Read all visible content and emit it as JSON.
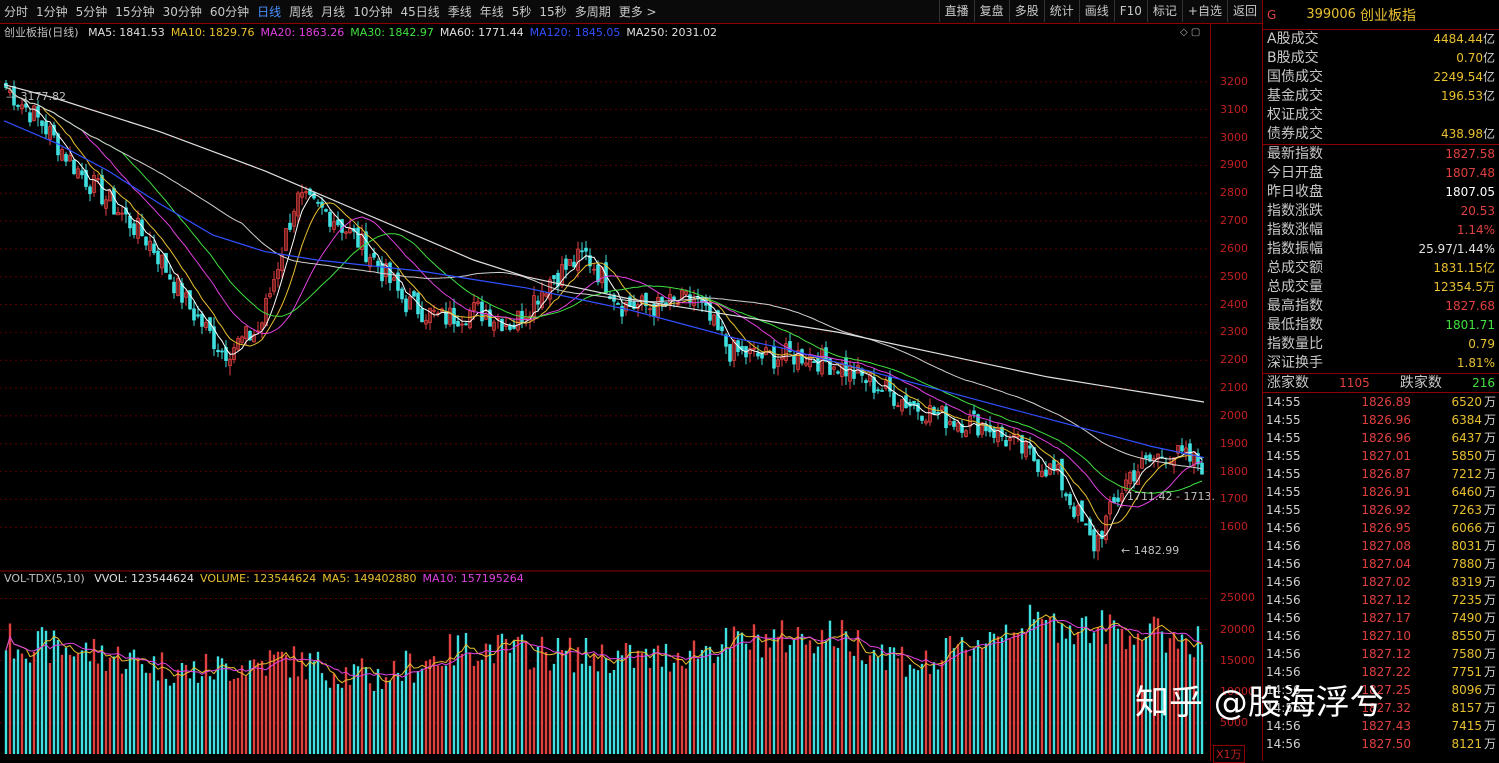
{
  "toolbar": {
    "periods": [
      "分时",
      "1分钟",
      "5分钟",
      "15分钟",
      "30分钟",
      "60分钟",
      "日线",
      "周线",
      "月线",
      "10分钟",
      "45日线",
      "季线",
      "年线",
      "5秒",
      "15秒",
      "多周期",
      "更多 >"
    ],
    "active_period": "日线",
    "right_buttons": [
      "直播",
      "复盘",
      "多股",
      "统计",
      "画线",
      "F10",
      "标记",
      "+自选",
      "返回"
    ]
  },
  "main_legend": {
    "title": "创业板指(日线)",
    "items": [
      {
        "label": "MA5: 1841.53",
        "color": "#e0e0e0"
      },
      {
        "label": "MA10: 1829.76",
        "color": "#e8c030"
      },
      {
        "label": "MA20: 1863.26",
        "color": "#e040e0"
      },
      {
        "label": "MA30: 1842.97",
        "color": "#40e040"
      },
      {
        "label": "MA60: 1771.44",
        "color": "#e0e0e0"
      },
      {
        "label": "MA120: 1845.05",
        "color": "#3050ff"
      },
      {
        "label": "MA250: 2031.02",
        "color": "#e0e0e0"
      }
    ]
  },
  "vol_legend": {
    "title": "VOL-TDX(5,10)",
    "items": [
      {
        "label": "VVOL: 123544624",
        "color": "#e0e0e0"
      },
      {
        "label": "VOLUME: 123544624",
        "color": "#e8c030"
      },
      {
        "label": "MA5: 149402880",
        "color": "#e8c030"
      },
      {
        "label": "MA10: 157195264",
        "color": "#e040e0"
      }
    ]
  },
  "annotations": {
    "high": "3177.82",
    "low": "1482.99",
    "range": "1711.42 - 1713."
  },
  "y_axis": {
    "price_ticks": [
      "3200",
      "3100",
      "3000",
      "2900",
      "2800",
      "2700",
      "2600",
      "2500",
      "2400",
      "2300",
      "2200",
      "2100",
      "2000",
      "1900",
      "1800",
      "1700",
      "1600"
    ],
    "vol_ticks": [
      "25000",
      "20000",
      "15000",
      "10000",
      "5000"
    ],
    "unit": "X1万"
  },
  "colors": {
    "up": "#e04040",
    "down": "#40e0e0",
    "ma250": "#e0e0e0",
    "ma120": "#3050ff",
    "ma60": "#d0d0d0",
    "ma30": "#40e040",
    "ma20": "#e040e0",
    "ma10": "#e8c030",
    "ma5": "#ffffff"
  },
  "panel": {
    "marker": "G",
    "code": "399006",
    "name": "创业板指",
    "turnover": [
      {
        "k": "A股成交",
        "v": "4484.44",
        "u": "亿",
        "c": "#e8c030"
      },
      {
        "k": "B股成交",
        "v": "0.70",
        "u": "亿",
        "c": "#e8c030"
      },
      {
        "k": "国债成交",
        "v": "2249.54",
        "u": "亿",
        "c": "#e8c030"
      },
      {
        "k": "基金成交",
        "v": "196.53",
        "u": "亿",
        "c": "#e8c030"
      },
      {
        "k": "权证成交",
        "v": "",
        "u": "",
        "c": "#e8c030"
      },
      {
        "k": "债券成交",
        "v": "438.98",
        "u": "亿",
        "c": "#e8c030"
      }
    ],
    "stats": [
      {
        "k": "最新指数",
        "v": "1827.58",
        "c": "#e04040"
      },
      {
        "k": "今日开盘",
        "v": "1807.48",
        "c": "#e04040"
      },
      {
        "k": "昨日收盘",
        "v": "1807.05",
        "c": "#ffffff"
      },
      {
        "k": "指数涨跌",
        "v": "20.53",
        "c": "#e04040"
      },
      {
        "k": "指数涨幅",
        "v": "1.14%",
        "c": "#e04040"
      },
      {
        "k": "指数振幅",
        "v": "25.97/1.44%",
        "c": "#e0e0e0"
      },
      {
        "k": "总成交额",
        "v": "1831.15亿",
        "c": "#e8c030"
      },
      {
        "k": "总成交量",
        "v": "12354.5万",
        "c": "#e8c030"
      },
      {
        "k": "最高指数",
        "v": "1827.68",
        "c": "#e04040"
      },
      {
        "k": "最低指数",
        "v": "1801.71",
        "c": "#40e040"
      },
      {
        "k": "指数量比",
        "v": "0.79",
        "c": "#e8c030"
      },
      {
        "k": "深证换手",
        "v": "1.81%",
        "c": "#e8c030"
      }
    ],
    "breadth": {
      "up_label": "涨家数",
      "up": "1105",
      "down_label": "跌家数",
      "down": "216"
    },
    "ticks": [
      {
        "t": "14:55",
        "p": "1826.89",
        "q": "6520",
        "u": "万"
      },
      {
        "t": "14:55",
        "p": "1826.96",
        "q": "6384",
        "u": "万"
      },
      {
        "t": "14:55",
        "p": "1826.96",
        "q": "6437",
        "u": "万"
      },
      {
        "t": "14:55",
        "p": "1827.01",
        "q": "5850",
        "u": "万"
      },
      {
        "t": "14:55",
        "p": "1826.87",
        "q": "7212",
        "u": "万"
      },
      {
        "t": "14:55",
        "p": "1826.91",
        "q": "6460",
        "u": "万"
      },
      {
        "t": "14:55",
        "p": "1826.92",
        "q": "7263",
        "u": "万"
      },
      {
        "t": "14:56",
        "p": "1826.95",
        "q": "6066",
        "u": "万"
      },
      {
        "t": "14:56",
        "p": "1827.08",
        "q": "8031",
        "u": "万"
      },
      {
        "t": "14:56",
        "p": "1827.04",
        "q": "7880",
        "u": "万"
      },
      {
        "t": "14:56",
        "p": "1827.02",
        "q": "8319",
        "u": "万"
      },
      {
        "t": "14:56",
        "p": "1827.12",
        "q": "7235",
        "u": "万"
      },
      {
        "t": "14:56",
        "p": "1827.17",
        "q": "7490",
        "u": "万"
      },
      {
        "t": "14:56",
        "p": "1827.10",
        "q": "8550",
        "u": "万"
      },
      {
        "t": "14:56",
        "p": "1827.12",
        "q": "7580",
        "u": "万"
      },
      {
        "t": "14:56",
        "p": "1827.22",
        "q": "7751",
        "u": "万"
      },
      {
        "t": "14:56",
        "p": "1827.25",
        "q": "8096",
        "u": "万"
      },
      {
        "t": "14:56",
        "p": "1827.32",
        "q": "8157",
        "u": "万"
      },
      {
        "t": "14:56",
        "p": "1827.43",
        "q": "7415",
        "u": "万"
      },
      {
        "t": "14:56",
        "p": "1827.50",
        "q": "8121",
        "u": "万"
      }
    ]
  },
  "watermark": "知乎 @股海浮兮",
  "chart_data": {
    "type": "line",
    "price_range": [
      1450,
      3300
    ],
    "series": [
      {
        "name": "MA250",
        "values": [
          3190,
          3140,
          3080,
          3020,
          2950,
          2880,
          2800,
          2720,
          2640,
          2560,
          2500,
          2460,
          2420,
          2390,
          2360,
          2330,
          2300,
          2260,
          2220,
          2180,
          2140,
          2110,
          2080,
          2050
        ]
      },
      {
        "name": "MA120",
        "values": [
          3060,
          2980,
          2880,
          2760,
          2650,
          2590,
          2560,
          2540,
          2520,
          2490,
          2460,
          2420,
          2380,
          2330,
          2280,
          2240,
          2190,
          2140,
          2090,
          2040,
          1990,
          1940,
          1890,
          1850
        ]
      }
    ],
    "close_samples": [
      3180,
      3050,
      2880,
      2750,
      2620,
      2400,
      2230,
      2310,
      2780,
      2720,
      2590,
      2410,
      2350,
      2380,
      2330,
      2490,
      2580,
      2400,
      2390,
      2420,
      2230,
      2210,
      2220,
      2180,
      2110,
      2040,
      1990,
      1970,
      1880,
      1790,
      1530,
      1790,
      1870,
      1828
    ]
  }
}
